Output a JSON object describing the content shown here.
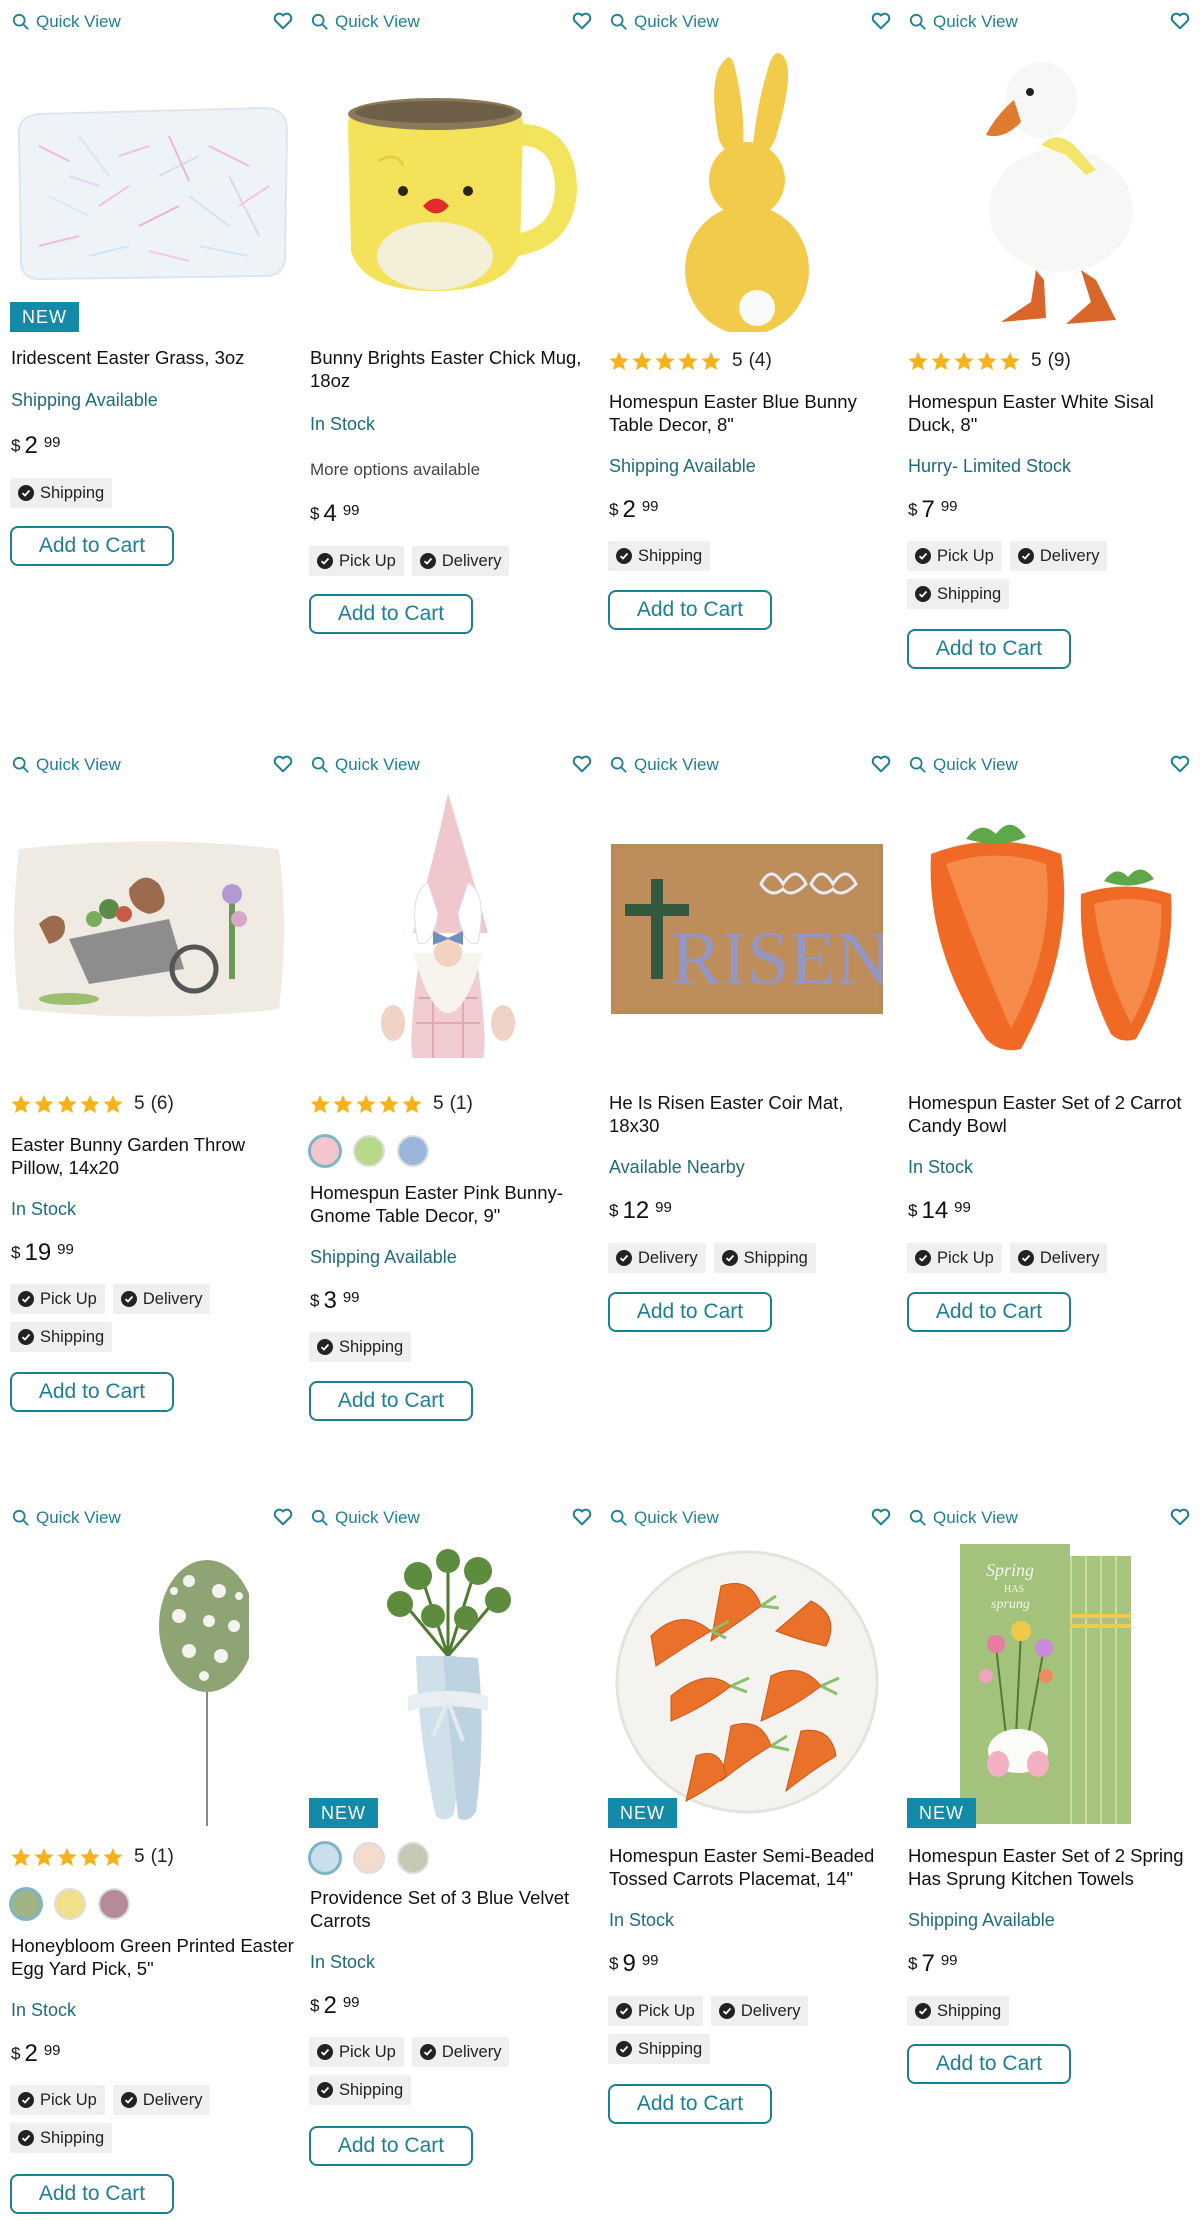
{
  "common": {
    "quick_view": "Quick View",
    "add_to_cart": "Add to Cart",
    "new_label": "NEW",
    "currency": "$",
    "accent_color": "#1d7f95",
    "star_color": "#f7b21b"
  },
  "products": [
    {
      "title": "Iridescent Easter Grass, 3oz",
      "stock": "Shipping Available",
      "price_dollars": "2",
      "price_cents": "99",
      "chips": [
        "Shipping"
      ],
      "badge": "NEW",
      "image": "easter-grass-bag"
    },
    {
      "title": "Bunny Brights Easter Chick Mug, 18oz",
      "stock": "In Stock",
      "more": "More options available",
      "price_dollars": "4",
      "price_cents": "99",
      "chips": [
        "Pick Up",
        "Delivery"
      ],
      "image": "chick-mug"
    },
    {
      "title": "Homespun Easter Blue Bunny Table Decor, 8\"",
      "rating": "5",
      "rating_count": "(4)",
      "stock": "Shipping Available",
      "price_dollars": "2",
      "price_cents": "99",
      "chips": [
        "Shipping"
      ],
      "image": "yellow-bunny"
    },
    {
      "title": "Homespun Easter White Sisal Duck, 8\"",
      "rating": "5",
      "rating_count": "(9)",
      "stock": "Hurry- Limited Stock",
      "price_dollars": "7",
      "price_cents": "99",
      "chips": [
        "Pick Up",
        "Delivery",
        "Shipping"
      ],
      "image": "white-duck"
    },
    {
      "title": "Easter Bunny Garden Throw Pillow, 14x20",
      "rating": "5",
      "rating_count": "(6)",
      "stock": "In Stock",
      "price_dollars": "19",
      "price_cents": "99",
      "chips": [
        "Pick Up",
        "Delivery",
        "Shipping"
      ],
      "image": "garden-pillow"
    },
    {
      "title": "Homespun Easter Pink Bunny-Gnome Table Decor, 9\"",
      "rating": "5",
      "rating_count": "(1)",
      "swatch_colors": [
        "#f2c6cc",
        "#b7d98c",
        "#9bb5dc"
      ],
      "stock": "Shipping Available",
      "price_dollars": "3",
      "price_cents": "99",
      "chips": [
        "Shipping"
      ],
      "image": "bunny-gnome"
    },
    {
      "title": "He Is Risen Easter Coir Mat, 18x30",
      "stock": "Available Nearby",
      "price_dollars": "12",
      "price_cents": "99",
      "chips": [
        "Delivery",
        "Shipping"
      ],
      "image": "coir-mat"
    },
    {
      "title": "Homespun Easter Set of 2 Carrot Candy Bowl",
      "stock": "In Stock",
      "price_dollars": "14",
      "price_cents": "99",
      "chips": [
        "Pick Up",
        "Delivery"
      ],
      "image": "carrot-bowls"
    },
    {
      "title": "Honeybloom Green Printed Easter Egg Yard Pick, 5\"",
      "rating": "5",
      "rating_count": "(1)",
      "swatch_colors": [
        "#9fb384",
        "#f1e08a",
        "#b58a9b"
      ],
      "stock": "In Stock",
      "price_dollars": "2",
      "price_cents": "99",
      "chips": [
        "Pick Up",
        "Delivery",
        "Shipping"
      ],
      "image": "egg-yard-pick"
    },
    {
      "title": "Providence Set of 3 Blue Velvet Carrots",
      "swatch_colors": [
        "#c9dfec",
        "#f3dccb",
        "#c5c9b5"
      ],
      "stock": "In Stock",
      "price_dollars": "2",
      "price_cents": "99",
      "chips": [
        "Pick Up",
        "Delivery",
        "Shipping"
      ],
      "badge": "NEW",
      "image": "velvet-carrots"
    },
    {
      "title": "Homespun Easter Semi-Beaded Tossed Carrots Placemat, 14\"",
      "stock": "In Stock",
      "price_dollars": "9",
      "price_cents": "99",
      "chips": [
        "Pick Up",
        "Delivery",
        "Shipping"
      ],
      "badge": "NEW",
      "image": "carrot-placemat"
    },
    {
      "title": "Homespun Easter Set of 2 Spring Has Sprung Kitchen Towels",
      "stock": "Shipping Available",
      "price_dollars": "7",
      "price_cents": "99",
      "chips": [
        "Shipping"
      ],
      "badge": "NEW",
      "image": "spring-towels"
    }
  ]
}
